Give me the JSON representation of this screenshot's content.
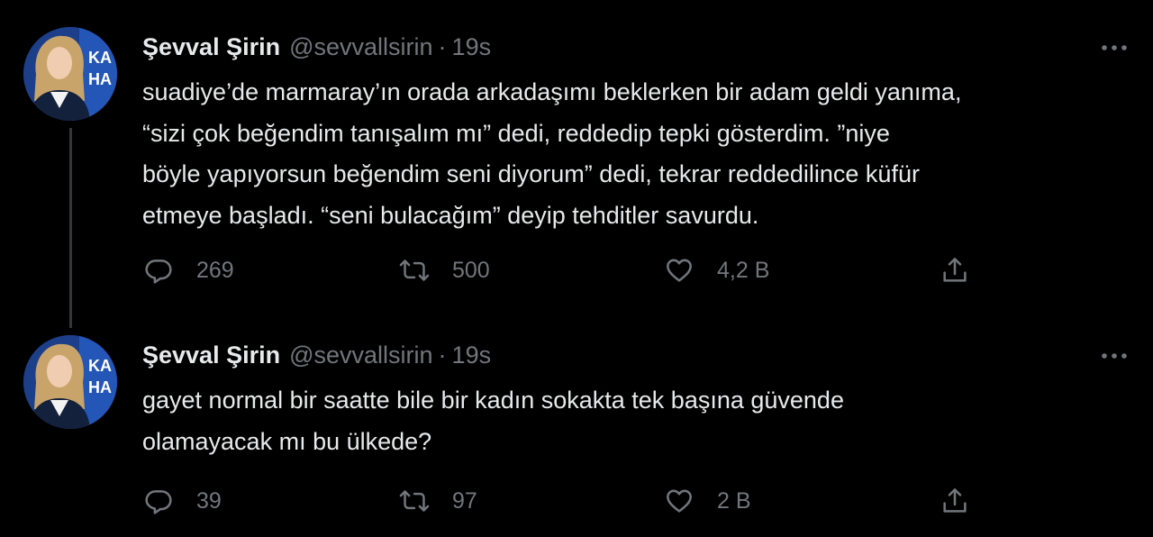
{
  "tweets": [
    {
      "author": {
        "name": "Şevval Şirin",
        "handle": "@sevvallsirin",
        "separator": "·",
        "time": "19s"
      },
      "text_lines": [
        "suadiye’de marmaray’ın orada arkadaşımı beklerken bir adam geldi yanıma,",
        "“sizi çok beğendim tanışalım mı” dedi, reddedip tepki gösterdim. ”niye",
        "böyle yapıyorsun beğendim seni diyorum” dedi, tekrar reddedilince küfür",
        "etmeye başladı. “seni bulacağım” deyip tehditler savurdu."
      ],
      "stats": {
        "replies": "269",
        "retweets": "500",
        "likes": "4,2 B"
      },
      "avatar_lettering": [
        "KA",
        "HA"
      ]
    },
    {
      "author": {
        "name": "Şevval Şirin",
        "handle": "@sevvallsirin",
        "separator": "·",
        "time": "19s"
      },
      "text_lines": [
        "gayet normal bir saatte bile bir kadın sokakta tek başına güvende",
        "olamayacak mı bu ülkede?"
      ],
      "stats": {
        "replies": "39",
        "retweets": "97",
        "likes": "2 B"
      },
      "avatar_lettering": [
        "KA",
        "HA"
      ]
    }
  ],
  "icons": {
    "reply": "reply-icon",
    "retweet": "retweet-icon",
    "like": "heart-icon",
    "share": "share-icon",
    "more": "more-icon"
  },
  "colors": {
    "background": "#000000",
    "text_primary": "#e7e9ea",
    "text_secondary": "#71767b",
    "thread_line": "#333639",
    "avatar_bg": "#1d3f8a"
  }
}
